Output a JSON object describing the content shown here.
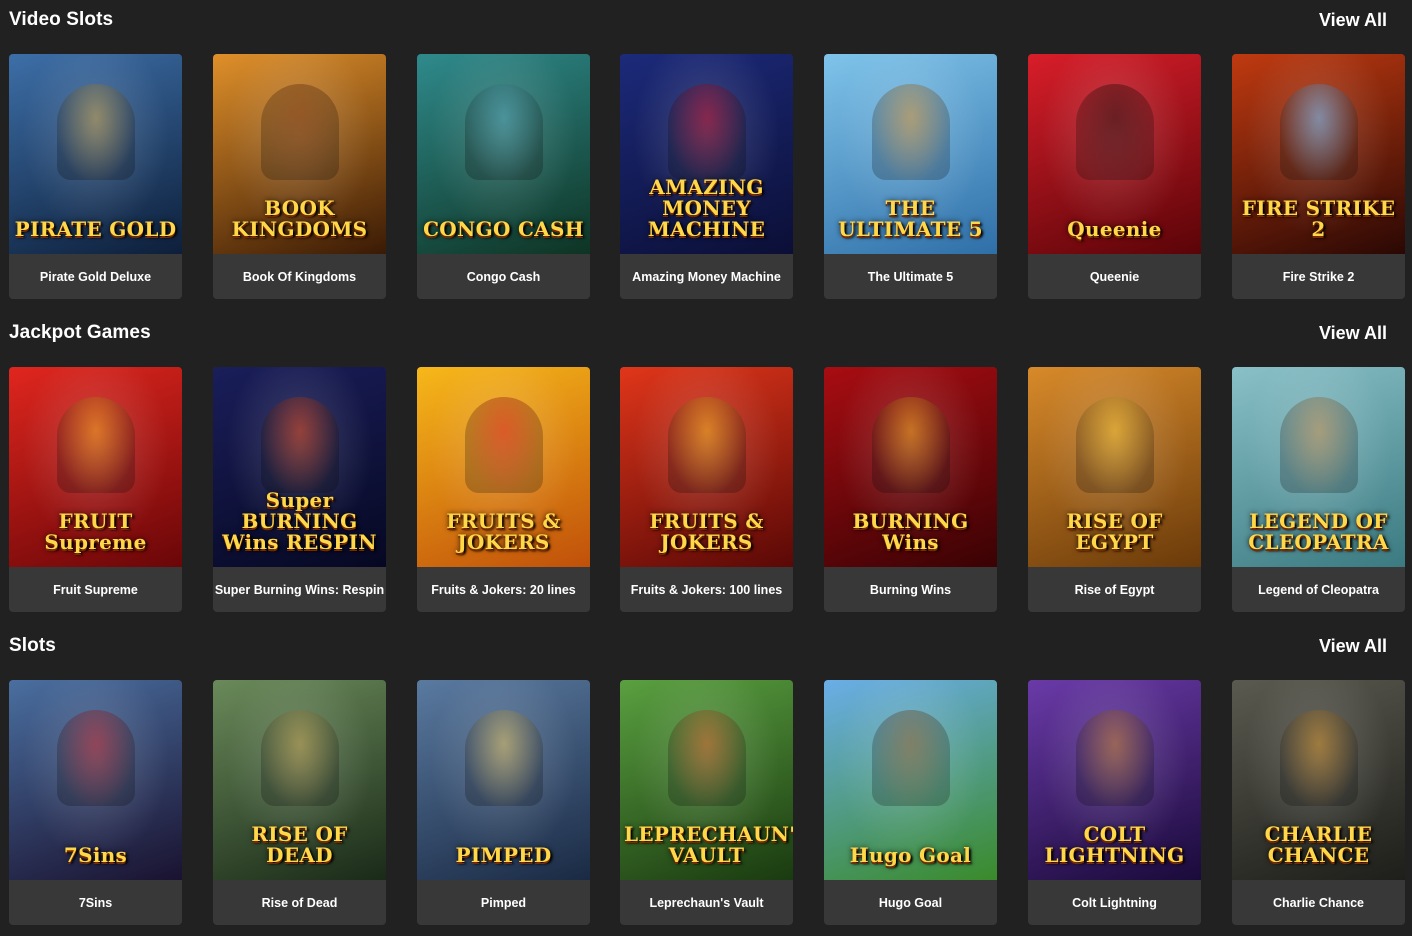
{
  "sections": [
    {
      "title": "Video Slots",
      "view_all": "View All",
      "games": [
        {
          "name": "Pirate Gold Deluxe",
          "art_title": "PIRATE GOLD",
          "bg": [
            "#3d6fa8",
            "#0d1f3a"
          ],
          "accent": "#c9a24a"
        },
        {
          "name": "Book Of Kingdoms",
          "art_title": "BOOK KINGDOMS",
          "bg": [
            "#e0902a",
            "#3a1a05"
          ],
          "accent": "#7a3a12"
        },
        {
          "name": "Congo Cash",
          "art_title": "CONGO CASH",
          "bg": [
            "#2f8a8c",
            "#0e3424"
          ],
          "accent": "#4fa0b0"
        },
        {
          "name": "Amazing Money Machine",
          "art_title": "AMAZING MONEY MACHINE",
          "bg": [
            "#1c2a7a",
            "#0b0f36"
          ],
          "accent": "#c4122a"
        },
        {
          "name": "The Ultimate 5",
          "art_title": "THE ULTIMATE 5",
          "bg": [
            "#7fc4ea",
            "#2f6fa8"
          ],
          "accent": "#d08a2a"
        },
        {
          "name": "Queenie",
          "art_title": "Queenie",
          "bg": [
            "#d81e2a",
            "#5a0408"
          ],
          "accent": "#2a0a0a"
        },
        {
          "name": "Fire Strike 2",
          "art_title": "FIRE STRIKE 2",
          "bg": [
            "#c03a10",
            "#2a0804"
          ],
          "accent": "#6fc0ff"
        }
      ]
    },
    {
      "title": "Jackpot Games",
      "view_all": "View All",
      "games": [
        {
          "name": "Fruit Supreme",
          "art_title": "FRUIT Supreme",
          "bg": [
            "#e0261e",
            "#6a0608"
          ],
          "accent": "#f2a21a"
        },
        {
          "name": "Super Burning Wins: Respin",
          "art_title": "Super BURNING Wins RESPIN",
          "bg": [
            "#1a1e5a",
            "#060822"
          ],
          "accent": "#e0461a"
        },
        {
          "name": "Fruits & Jokers: 20 lines",
          "art_title": "FRUITS & JOKERS",
          "bg": [
            "#f7b81a",
            "#c0500a"
          ],
          "accent": "#d0201a"
        },
        {
          "name": "Fruits & Jokers: 100 lines",
          "art_title": "FRUITS & JOKERS",
          "bg": [
            "#e0361a",
            "#5a0806"
          ],
          "accent": "#f0b01a"
        },
        {
          "name": "Burning Wins",
          "art_title": "BURNING Wins",
          "bg": [
            "#a80d12",
            "#3a0204"
          ],
          "accent": "#f0a81a"
        },
        {
          "name": "Rise of Egypt",
          "art_title": "RISE OF EGYPT",
          "bg": [
            "#d88a2a",
            "#6a3a0a"
          ],
          "accent": "#f2c030"
        },
        {
          "name": "Legend of Cleopatra",
          "art_title": "LEGEND OF CLEOPATRA",
          "bg": [
            "#8ac0c8",
            "#3a7a80"
          ],
          "accent": "#c08a4a"
        }
      ]
    },
    {
      "title": "Slots",
      "view_all": "View All",
      "games": [
        {
          "name": "7Sins",
          "art_title": "7Sins",
          "bg": [
            "#4a6fa0",
            "#1a1230"
          ],
          "accent": "#c02a30"
        },
        {
          "name": "Rise of Dead",
          "art_title": "RISE OF DEAD",
          "bg": [
            "#6a8a5a",
            "#1a2a18"
          ],
          "accent": "#c0a050"
        },
        {
          "name": "Pimped",
          "art_title": "PIMPED",
          "bg": [
            "#5a7aa0",
            "#1a2a44"
          ],
          "accent": "#e0c060"
        },
        {
          "name": "Leprechaun's Vault",
          "art_title": "LEPRECHAUN'S VAULT",
          "bg": [
            "#5aa040",
            "#1a3a10"
          ],
          "accent": "#d0602a"
        },
        {
          "name": "Hugo Goal",
          "art_title": "Hugo Goal",
          "bg": [
            "#6aaee8",
            "#3a8a2a"
          ],
          "accent": "#8a5a2a"
        },
        {
          "name": "Colt Lightning",
          "art_title": "COLT LIGHTNING",
          "bg": [
            "#6a3aa8",
            "#1a0a3a"
          ],
          "accent": "#c07a2a"
        },
        {
          "name": "Charlie Chance",
          "art_title": "CHARLIE CHANCE",
          "bg": [
            "#5a5a50",
            "#1e1e1a"
          ],
          "accent": "#d0902a"
        }
      ]
    }
  ]
}
